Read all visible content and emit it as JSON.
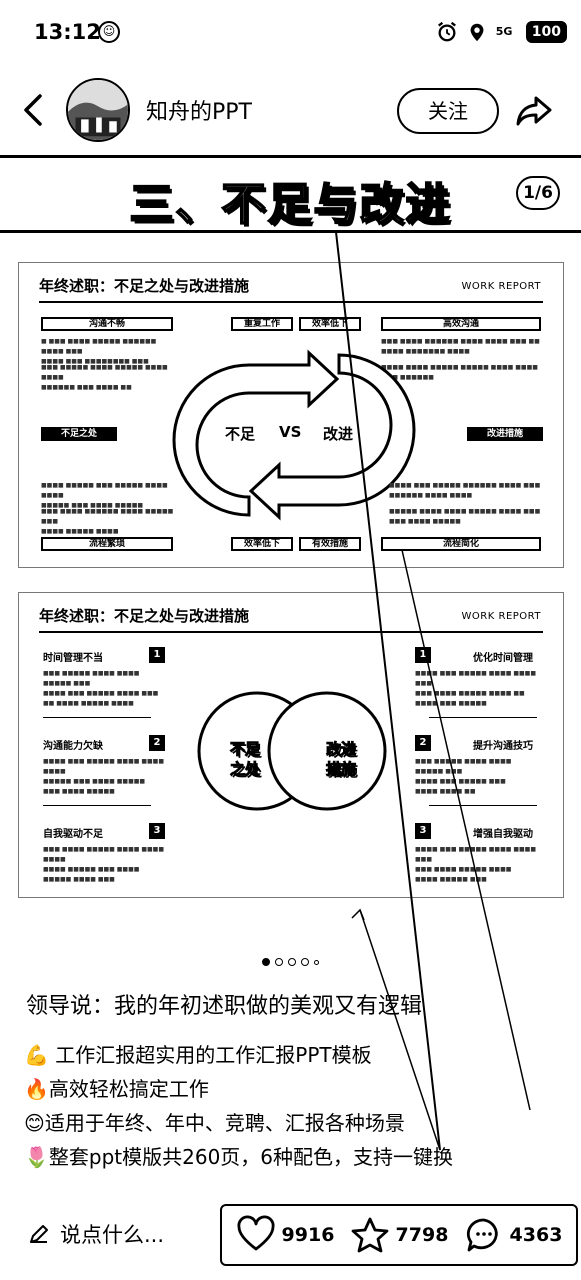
{
  "status_bar": {
    "time": "13:12",
    "network": "5G",
    "battery": "100"
  },
  "header": {
    "author_name": "知舟的PPT",
    "follow_label": "关注"
  },
  "banner": {
    "title": "三、不足与改进",
    "pager": "1/6"
  },
  "slide1": {
    "title": "年终述职：不足之处与改进措施",
    "report": "WORK REPORT",
    "center_left": "不足",
    "center_vs": "VS",
    "center_right": "改进",
    "bars": {
      "top_left": "沟通不畅",
      "top_mid_a": "重复工作",
      "top_mid_b": "效率低下",
      "top_right": "高效沟通",
      "mid_left": "不足之处",
      "mid_right": "改进措施",
      "bot_left": "流程繁琐",
      "bot_mid_a": "效率低下",
      "bot_mid_b": "有效措施",
      "bot_right": "流程简化"
    }
  },
  "slide2": {
    "title": "年终述职：不足之处与改进措施",
    "report": "WORK REPORT",
    "circle_left": "不足\n之处",
    "circle_right": "改进\n措施",
    "left_items": [
      {
        "title": "时间管理不当",
        "num": "1"
      },
      {
        "title": "沟通能力欠缺",
        "num": "2"
      },
      {
        "title": "自我驱动不足",
        "num": "3"
      }
    ],
    "right_items": [
      {
        "title": "优化时间管理",
        "num": "1"
      },
      {
        "title": "提升沟通技巧",
        "num": "2"
      },
      {
        "title": "增强自我驱动",
        "num": "3"
      }
    ]
  },
  "post": {
    "headline": "领导说：我的年初述职做的美观又有逻辑",
    "lines": [
      "💪 工作汇报超实用的工作汇报PPT模板",
      "🔥高效轻松搞定工作",
      "😊适用于年终、年中、竞聘、汇报各种场景",
      "🌷整套ppt模版共260页，6种配色，支持一键换"
    ]
  },
  "bottom_bar": {
    "comment_placeholder": "说点什么...",
    "likes": "9916",
    "stars": "7798",
    "comments": "4363"
  }
}
